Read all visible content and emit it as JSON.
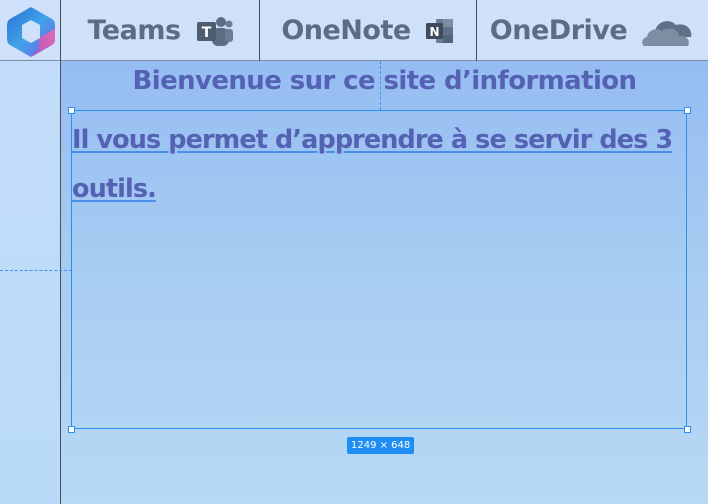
{
  "header": {
    "logo_icon": "microsoft-365-logo-icon",
    "nav": [
      {
        "label": "Teams",
        "icon": "teams-icon"
      },
      {
        "label": "OneNote",
        "icon": "onenote-icon"
      },
      {
        "label": "OneDrive",
        "icon": "onedrive-icon"
      }
    ]
  },
  "main": {
    "welcome_title": "Bienvenue sur ce site d’information",
    "body_text": "Il vous permet d’apprendre à se servir des 3 outils. ",
    "selection_size_badge": "1249 × 648"
  },
  "colors": {
    "accent_selection": "#2b8ff0",
    "heading_text": "#5562b4",
    "nav_text": "#5b6d82"
  }
}
